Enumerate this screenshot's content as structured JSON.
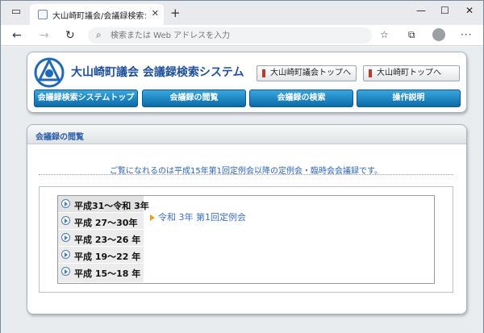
{
  "browser": {
    "tab_title": "大山崎町議会/会議録検索システ",
    "tab_close": "✕",
    "new_tab": "+",
    "address_placeholder": "検索または Web アドレスを入力",
    "window_controls": {
      "minimize": "—",
      "maximize": "☐",
      "close": "✕"
    },
    "nav": {
      "back": "←",
      "forward": "→",
      "reload": "↻"
    }
  },
  "header": {
    "site_title": "大山崎町議会  会議録検索システム",
    "top_links": [
      {
        "label": "大山崎町議会トップへ"
      },
      {
        "label": "大山崎町トップへ"
      }
    ],
    "nav_buttons": [
      {
        "label": "会議録検索システムトップ"
      },
      {
        "label": "会議録の閲覧"
      },
      {
        "label": "会議録の検索"
      },
      {
        "label": "操作説明"
      }
    ]
  },
  "main": {
    "section_title": "会議録の閲覧",
    "notice": "ご覧になれるのは平成15年第1回定例会以降の定例会・臨時会会議録です。",
    "years": [
      {
        "label": "平成31～令和 3年"
      },
      {
        "label": "平成 27～30年"
      },
      {
        "label": "平成 23～26 年"
      },
      {
        "label": "平成 19～22 年"
      },
      {
        "label": "平成 15～18 年"
      }
    ],
    "sessions": [
      {
        "label": "令和 3年 第1回定例会"
      }
    ]
  },
  "colors": {
    "nav_button": "#1b86c8",
    "site_title": "#1c4f9c",
    "link": "#3d6fd1"
  }
}
